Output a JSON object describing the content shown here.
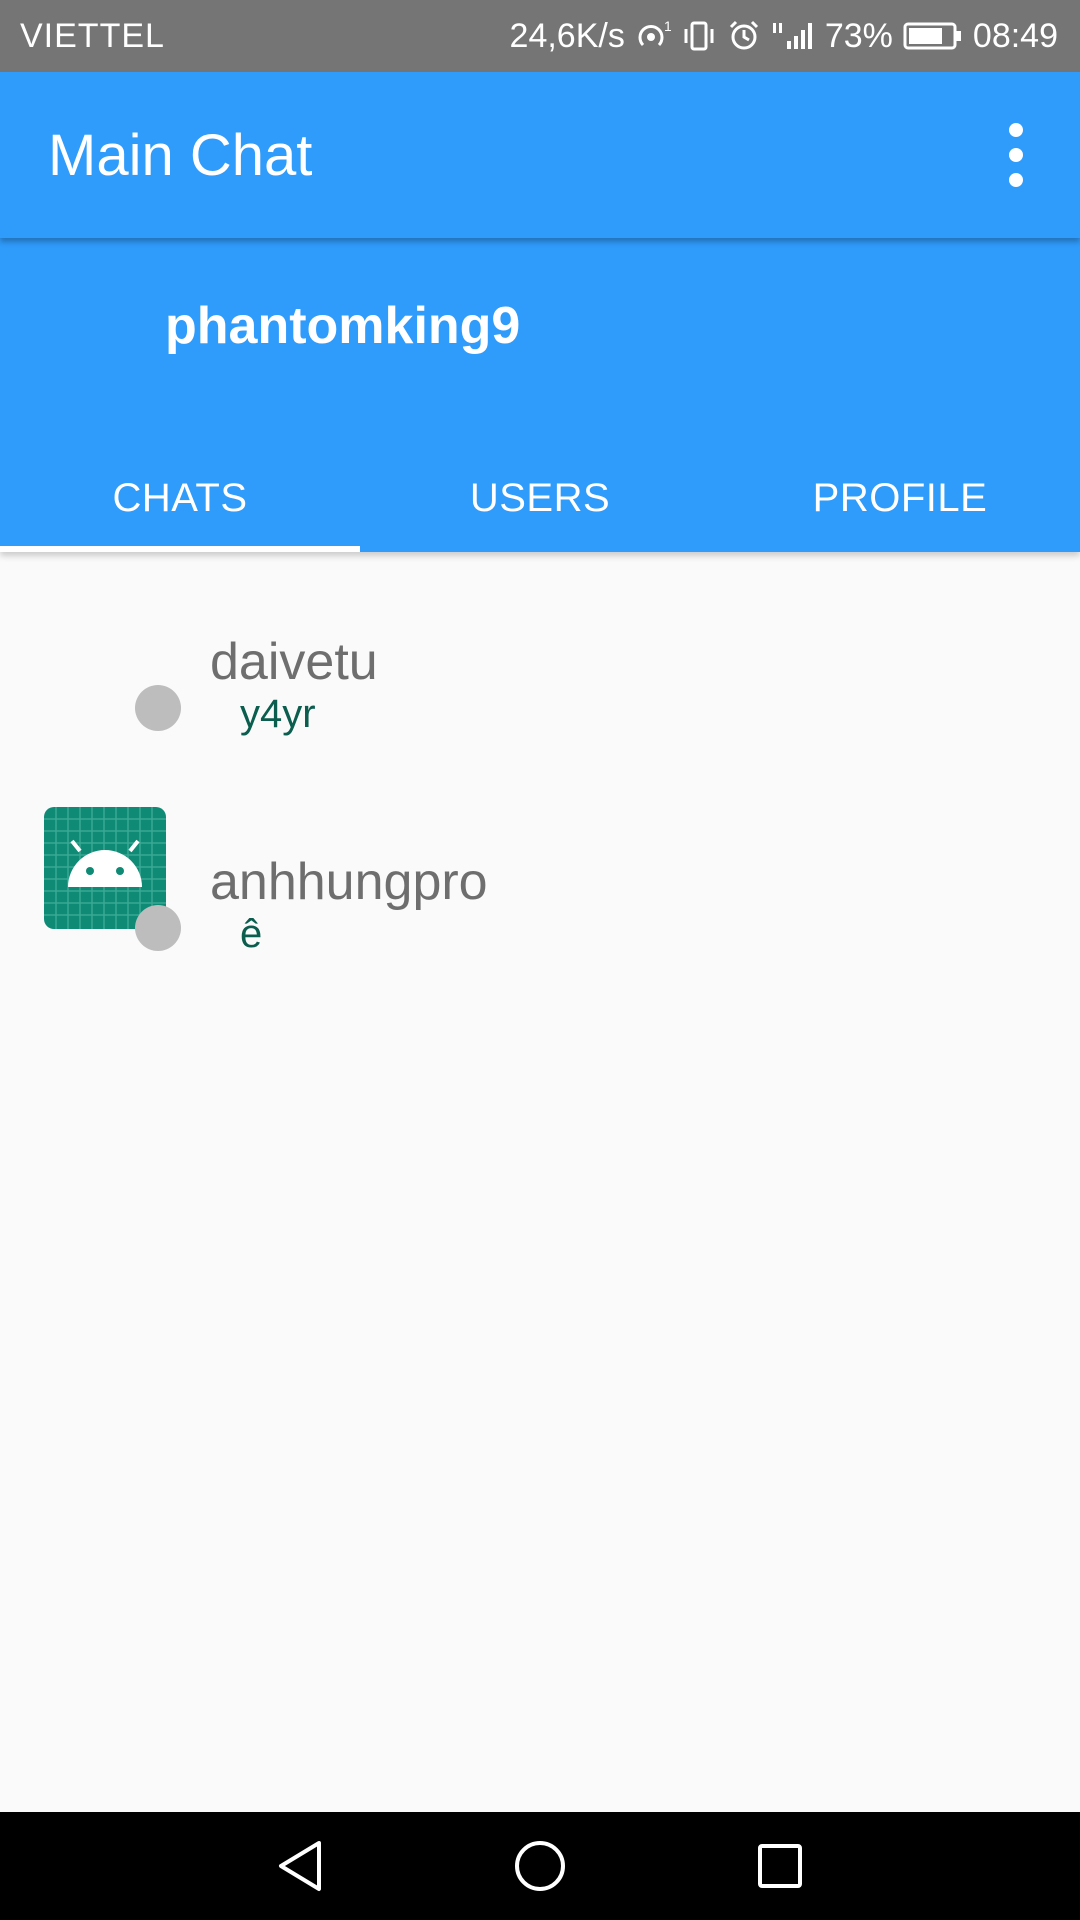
{
  "status_bar": {
    "carrier": "VIETTEL",
    "speed": "24,6K/s",
    "battery": "73%",
    "time": "08:49"
  },
  "toolbar": {
    "title": "Main Chat",
    "overflow_icon": "more-vert-icon"
  },
  "header": {
    "username": "phantomking9"
  },
  "tabs": [
    {
      "label": "CHATS",
      "active": true
    },
    {
      "label": "USERS",
      "active": false
    },
    {
      "label": "PROFILE",
      "active": false
    }
  ],
  "chats": [
    {
      "name": "daivetu",
      "last_message": "y4yr",
      "has_avatar": false,
      "status_color": "#bdbdbd"
    },
    {
      "name": "anhhungpro",
      "last_message": "ê",
      "has_avatar": true,
      "status_color": "#bdbdbd"
    }
  ],
  "colors": {
    "primary": "#2f9bfb",
    "status_bar": "#757575",
    "message_text": "#0b5d4e",
    "avatar_bg": "#0f8a75"
  },
  "nav": {
    "back_icon": "back-triangle-icon",
    "home_icon": "home-circle-icon",
    "recents_icon": "recents-square-icon"
  }
}
